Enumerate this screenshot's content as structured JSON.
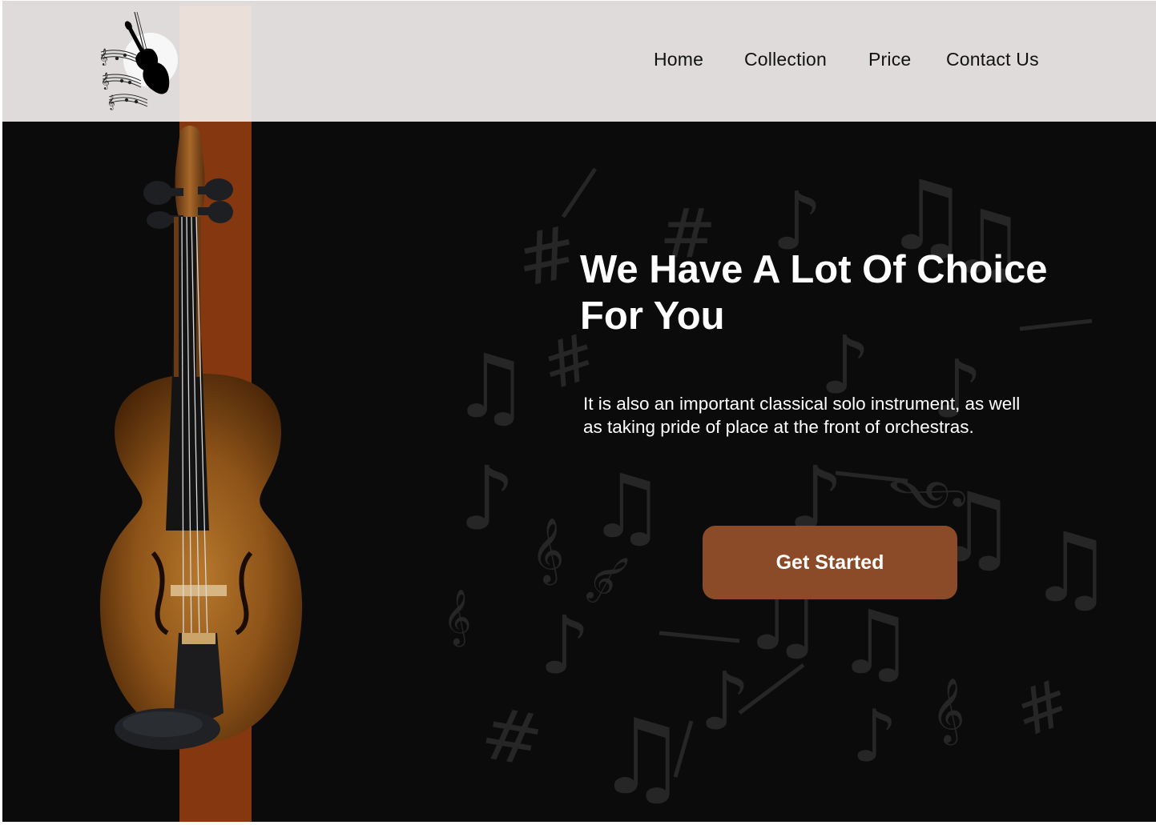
{
  "nav": {
    "items": [
      {
        "label": "Home"
      },
      {
        "label": "Collection"
      },
      {
        "label": "Price"
      },
      {
        "label": "Contact Us"
      }
    ]
  },
  "logo": {
    "icon": "violin-music-notes-logo"
  },
  "hero": {
    "headline_line1": "We Have A Lot Of Choice",
    "headline_line2": "For You",
    "description": "It is also an important classical solo instrument, as well as taking pride of place at the front of orchestras.",
    "cta_label": "Get Started",
    "image": "violin-image",
    "background": "music-notes-pattern"
  },
  "colors": {
    "header_bg": "#dedbda",
    "page_bg": "#0b0b0b",
    "accent_stripe": "#85380f",
    "cta_bg": "#8b4b28",
    "text_light": "#ffffff"
  }
}
